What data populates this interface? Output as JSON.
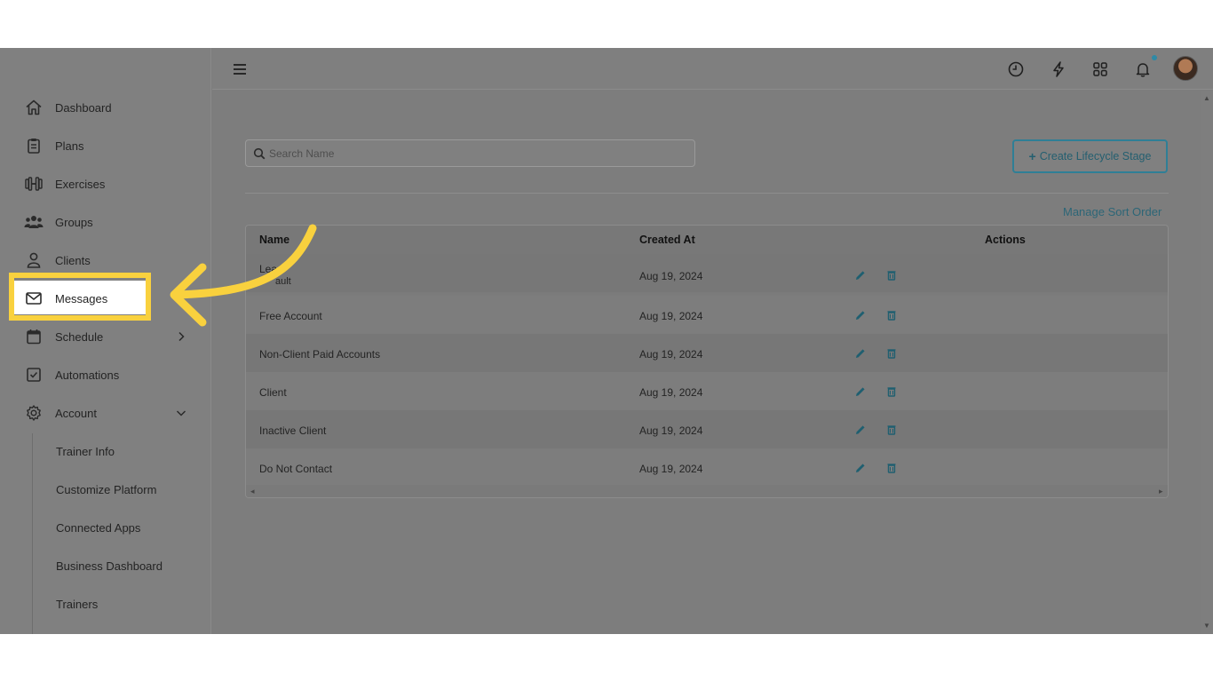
{
  "sidebar": {
    "items": [
      {
        "label": "Dashboard",
        "icon": "home-icon"
      },
      {
        "label": "Plans",
        "icon": "clipboard-icon"
      },
      {
        "label": "Exercises",
        "icon": "dumbbell-icon"
      },
      {
        "label": "Groups",
        "icon": "users-icon"
      },
      {
        "label": "Clients",
        "icon": "user-icon"
      },
      {
        "label": "Messages",
        "icon": "mail-icon"
      },
      {
        "label": "Schedule",
        "icon": "calendar-icon"
      },
      {
        "label": "Automations",
        "icon": "checkbox-icon"
      },
      {
        "label": "Account",
        "icon": "gear-icon"
      }
    ],
    "account_sub": [
      "Trainer Info",
      "Customize Platform",
      "Connected Apps",
      "Business Dashboard",
      "Trainers"
    ]
  },
  "topbar": {
    "icons": [
      "menu-icon",
      "clock-icon",
      "bolt-icon",
      "apps-grid-icon",
      "bell-icon",
      "avatar"
    ]
  },
  "main": {
    "search_placeholder": "Search Name",
    "create_label": "Create Lifecycle Stage",
    "create_plus": "+",
    "sort_label": "Manage Sort Order",
    "table": {
      "headers": {
        "name": "Name",
        "created": "Created At",
        "actions": "Actions"
      },
      "rows": [
        {
          "name": "Lea",
          "name_line2": "ault",
          "created": "Aug 19, 2024"
        },
        {
          "name": "Free Account",
          "created": "Aug 19, 2024"
        },
        {
          "name": "Non-Client Paid Accounts",
          "created": "Aug 19, 2024"
        },
        {
          "name": "Client",
          "created": "Aug 19, 2024"
        },
        {
          "name": "Inactive Client",
          "created": "Aug 19, 2024"
        },
        {
          "name": "Do Not Contact",
          "created": "Aug 19, 2024"
        }
      ]
    }
  },
  "colors": {
    "accent": "#2f7f96",
    "highlight": "#f9d13e",
    "overlay": "#7d7d7d"
  }
}
